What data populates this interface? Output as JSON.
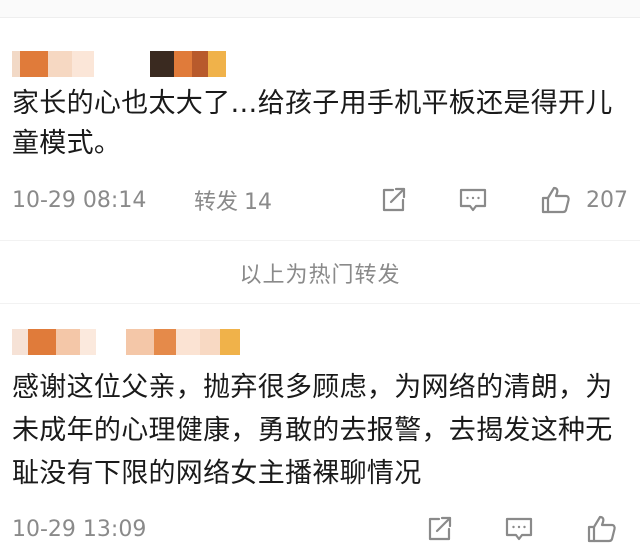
{
  "reposts": [
    {
      "content": "家长的心也太大了…给孩子用手机平板还是得开儿童模式。",
      "timestamp": "10-29 08:14",
      "repost_label": "转发",
      "repost_count": "14",
      "like_count": "207",
      "share_icon": "share-square-arrow-icon",
      "comment_icon": "comment-bubble-icon",
      "like_icon": "thumbs-up-icon"
    },
    {
      "content": "感谢这位父亲，抛弃很多顾虑，为网络的清朗，为未成年的心理健康，勇敢的去报警，去揭发这种无耻没有下限的网络女主播裸聊情况",
      "timestamp": "10-29 13:09",
      "share_icon": "share-square-arrow-icon",
      "comment_icon": "comment-bubble-icon",
      "like_icon": "thumbs-up-icon"
    }
  ],
  "divider_label": "以上为热门转发",
  "colors": {
    "text": "#1a1a1a",
    "meta_text": "#8a8a8a",
    "divider_bg": "#ffffff",
    "blur_orange": "#e07b3a",
    "blur_peach": "#f4c7a8",
    "blur_dark": "#3a2a20",
    "blur_gold": "#f0b24a"
  }
}
